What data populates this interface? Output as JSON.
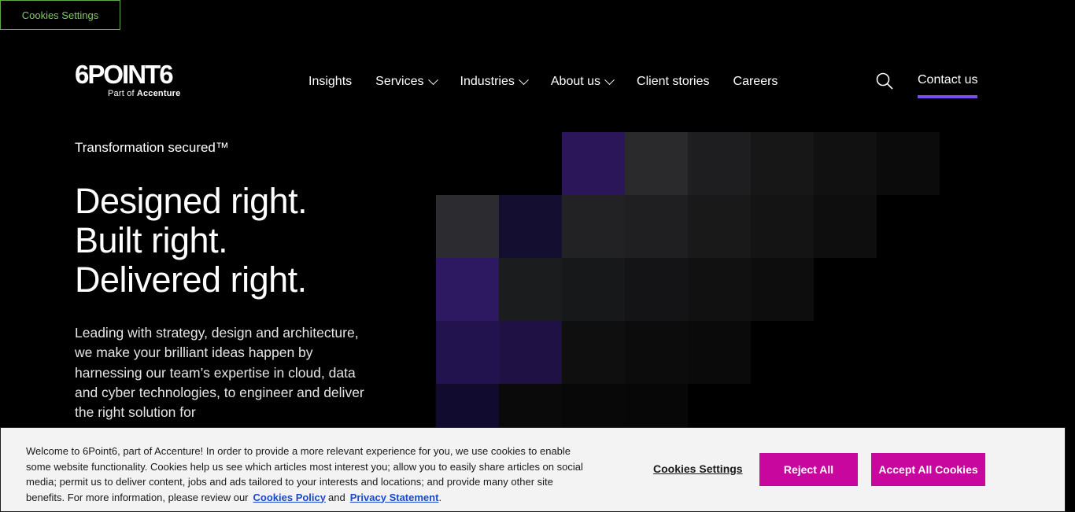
{
  "skip_link": {
    "label": "Cookies Settings"
  },
  "logo": {
    "main": "6POINT6",
    "part_of": "Part of",
    "brand": "Accenture"
  },
  "nav": {
    "items": [
      {
        "label": "Insights",
        "has_dropdown": false
      },
      {
        "label": "Services",
        "has_dropdown": true
      },
      {
        "label": "Industries",
        "has_dropdown": true
      },
      {
        "label": "About us",
        "has_dropdown": true
      },
      {
        "label": "Client stories",
        "has_dropdown": false
      },
      {
        "label": "Careers",
        "has_dropdown": false
      }
    ],
    "search_icon": "search-icon",
    "contact_label": "Contact us",
    "accent_color": "#7b4df0"
  },
  "hero": {
    "eyebrow": "Transformation secured™",
    "headline": [
      "Designed right.",
      "Built right.",
      "Delivered right."
    ],
    "lead": "Leading with strategy, design and architecture, we make your brilliant ideas happen by harnessing our team’s expertise in cloud, data and cyber technologies, to engineer and deliver the right solution for"
  },
  "cookie_banner": {
    "text": "Welcome to 6Point6, part of Accenture! In order to provide a more relevant experience for you, we use cookies to enable some website functionality. Cookies help us see which articles most interest you; allow you to easily share articles on social media; permit us to deliver content, jobs and ads tailored to your interests and locations; and provide many other site benefits. For more information, please review our",
    "policy_link": "Cookies Policy",
    "and": "and",
    "privacy_link": "Privacy Statement",
    "end": ".",
    "settings_label": "Cookies Settings",
    "reject_label": "Reject All",
    "accept_label": "Accept All Cookies",
    "button_color": "#c8079e"
  }
}
